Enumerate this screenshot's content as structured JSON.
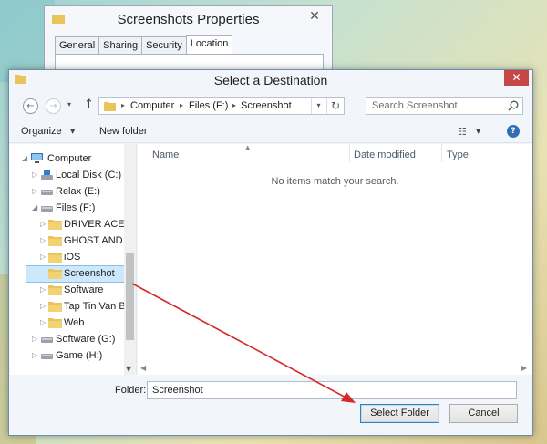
{
  "background_window": {
    "title": "Screenshots Properties",
    "close": "✕",
    "tabs": [
      "General",
      "Sharing",
      "Security",
      "Location"
    ],
    "active_tab": "Location"
  },
  "dialog": {
    "title": "Select a Destination",
    "close": "✕"
  },
  "address_bar": {
    "separator": "▸",
    "parts": [
      "Computer",
      "Files (F:)",
      "Screenshot"
    ],
    "dropdown": "▾",
    "refresh": "↻"
  },
  "search": {
    "placeholder": "Search Screenshot"
  },
  "toolbar": {
    "organize_label": "Organize",
    "organize_arrow": "▼",
    "new_folder_label": "New folder",
    "view_icon": "☷",
    "view_arrow": "▼",
    "help": "?"
  },
  "nav_buttons": {
    "back": "←",
    "forward": "→",
    "recent": "▾",
    "up": "↑"
  },
  "navigation_tree": [
    {
      "label": "Computer",
      "expanded": true,
      "icon": "computer-icon"
    },
    {
      "label": "Local Disk (C:)",
      "expanded": false,
      "icon": "drive-icon"
    },
    {
      "label": "Relax (E:)",
      "expanded": false,
      "icon": "drive-icon"
    },
    {
      "label": "Files (F:)",
      "expanded": true,
      "icon": "drive-icon"
    },
    {
      "label": "DRIVER ACER",
      "expanded": false,
      "icon": "folder-icon"
    },
    {
      "label": "GHOST AND IS",
      "expanded": false,
      "icon": "folder-icon"
    },
    {
      "label": "iOS",
      "expanded": false,
      "icon": "folder-icon"
    },
    {
      "label": "Screenshot",
      "expanded": false,
      "icon": "folder-icon",
      "selected": true
    },
    {
      "label": "Software",
      "expanded": false,
      "icon": "folder-icon"
    },
    {
      "label": "Tap Tin Van Ba",
      "expanded": false,
      "icon": "folder-icon"
    },
    {
      "label": "Web",
      "expanded": false,
      "icon": "folder-icon"
    },
    {
      "label": "Software (G:)",
      "expanded": false,
      "icon": "drive-icon"
    },
    {
      "label": "Game (H:)",
      "expanded": false,
      "icon": "drive-icon"
    }
  ],
  "tree_arrows": {
    "expanded": "◢",
    "collapsed": "▷"
  },
  "file_list": {
    "columns": [
      "Name",
      "Date modified",
      "Type"
    ],
    "sort_caret": "▲",
    "empty_message": "No items match your search.",
    "scroll_left": "◀",
    "scroll_right": "▶",
    "scroll_down": "▼"
  },
  "folder_field": {
    "label": "Folder:",
    "value": "Screenshot"
  },
  "buttons": {
    "select": "Select Folder",
    "cancel": "Cancel"
  },
  "colors": {
    "accent_arrow": "#d42a2a",
    "close_red": "#c74646",
    "selection_bg": "#cde8fb",
    "folder_yellow": "#e8c45a"
  }
}
